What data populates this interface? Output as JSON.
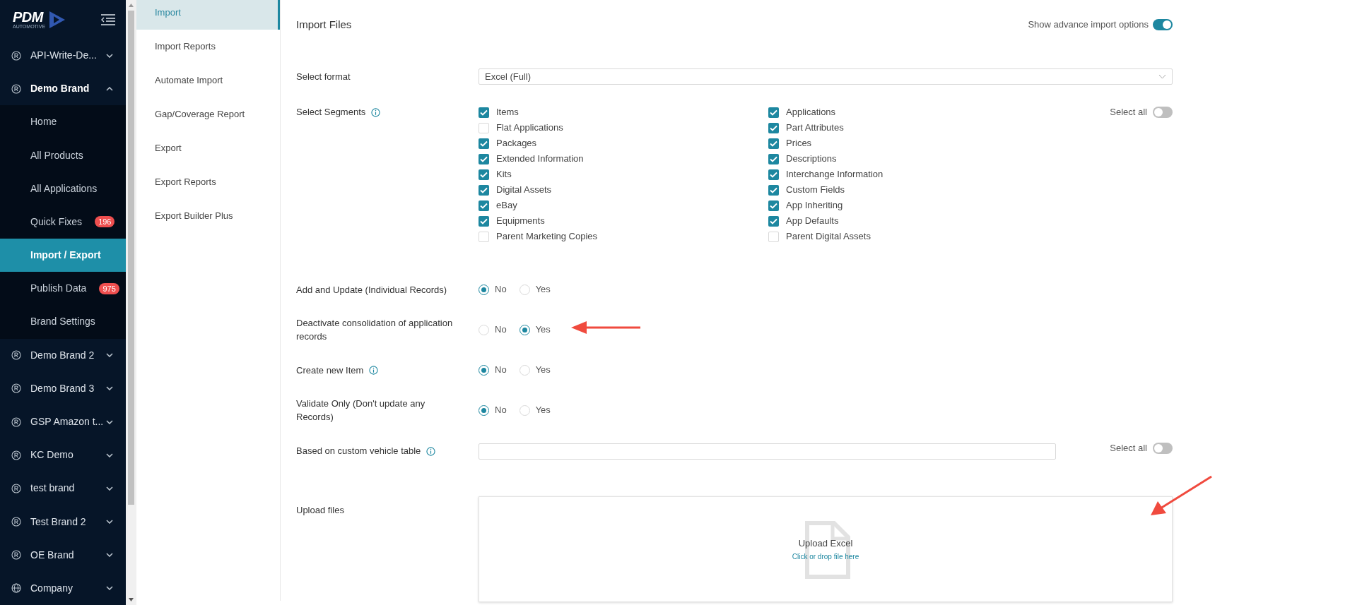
{
  "logo": {
    "wordmark": "PDM",
    "tagline": "AUTOMOTIVE"
  },
  "sidebar": {
    "items": [
      {
        "kind": "brand",
        "label": "API-Write-De...",
        "expanded": false,
        "selected": false
      },
      {
        "kind": "brand",
        "label": "Demo Brand",
        "expanded": true,
        "selected": false,
        "children": [
          {
            "label": "Home",
            "selected": false
          },
          {
            "label": "All Products",
            "selected": false
          },
          {
            "label": "All Applications",
            "selected": false
          },
          {
            "label": "Quick Fixes",
            "selected": false,
            "badge": "196"
          },
          {
            "label": "Import / Export",
            "selected": true
          },
          {
            "label": "Publish Data",
            "selected": false,
            "badge": "975"
          },
          {
            "label": "Brand Settings",
            "selected": false
          }
        ]
      },
      {
        "kind": "brand",
        "label": "Demo Brand 2",
        "expanded": false,
        "selected": false
      },
      {
        "kind": "brand",
        "label": "Demo Brand 3",
        "expanded": false,
        "selected": false
      },
      {
        "kind": "brand",
        "label": "GSP Amazon t...",
        "expanded": false,
        "selected": false
      },
      {
        "kind": "brand",
        "label": "KC Demo",
        "expanded": false,
        "selected": false
      },
      {
        "kind": "brand",
        "label": "test brand",
        "expanded": false,
        "selected": false
      },
      {
        "kind": "brand",
        "label": "Test Brand 2",
        "expanded": false,
        "selected": false
      },
      {
        "kind": "brand",
        "label": "OE Brand",
        "expanded": false,
        "selected": false
      },
      {
        "kind": "company",
        "label": "Company",
        "expanded": false,
        "selected": false
      }
    ]
  },
  "submenu": [
    {
      "label": "Import",
      "selected": true
    },
    {
      "label": "Import Reports",
      "selected": false
    },
    {
      "label": "Automate Import",
      "selected": false
    },
    {
      "label": "Gap/Coverage Report",
      "selected": false
    },
    {
      "label": "Export",
      "selected": false
    },
    {
      "label": "Export Reports",
      "selected": false
    },
    {
      "label": "Export Builder Plus",
      "selected": false
    }
  ],
  "main": {
    "title": "Import Files",
    "advanced_toggle": {
      "label": "Show advance import options",
      "on": true
    },
    "format": {
      "label": "Select format",
      "value": "Excel (Full)"
    },
    "segments": {
      "label": "Select Segments",
      "select_all": {
        "label": "Select all",
        "on": false
      },
      "columns": [
        [
          {
            "label": "Items",
            "checked": true
          },
          {
            "label": "Flat Applications",
            "checked": false
          },
          {
            "label": "Packages",
            "checked": true
          },
          {
            "label": "Extended Information",
            "checked": true
          },
          {
            "label": "Kits",
            "checked": true
          },
          {
            "label": "Digital Assets",
            "checked": true
          },
          {
            "label": "eBay",
            "checked": true
          },
          {
            "label": "Equipments",
            "checked": true
          },
          {
            "label": "Parent Marketing Copies",
            "checked": false
          }
        ],
        [
          {
            "label": "Applications",
            "checked": true
          },
          {
            "label": "Part Attributes",
            "checked": true
          },
          {
            "label": "Prices",
            "checked": true
          },
          {
            "label": "Descriptions",
            "checked": true
          },
          {
            "label": "Interchange Information",
            "checked": true
          },
          {
            "label": "Custom Fields",
            "checked": true
          },
          {
            "label": "App Inheriting",
            "checked": true
          },
          {
            "label": "App Defaults",
            "checked": true
          },
          {
            "label": "Parent Digital Assets",
            "checked": false
          }
        ]
      ]
    },
    "options": [
      {
        "label": "Add and Update (Individual Records)",
        "info": false,
        "choices": [
          {
            "label": "No",
            "selected": true
          },
          {
            "label": "Yes",
            "selected": false
          }
        ]
      },
      {
        "label": "Deactivate consolidation of application records",
        "info": false,
        "choices": [
          {
            "label": "No",
            "selected": false
          },
          {
            "label": "Yes",
            "selected": true
          }
        ]
      },
      {
        "label": "Create new Item",
        "info": true,
        "choices": [
          {
            "label": "No",
            "selected": true
          },
          {
            "label": "Yes",
            "selected": false
          }
        ]
      },
      {
        "label": "Validate Only (Don't update any Records)",
        "info": false,
        "choices": [
          {
            "label": "No",
            "selected": true
          },
          {
            "label": "Yes",
            "selected": false
          }
        ]
      }
    ],
    "vehicle_table": {
      "label": "Based on custom vehicle table",
      "select_all": {
        "label": "Select all",
        "on": false
      }
    },
    "upload": {
      "label": "Upload files",
      "title": "Upload Excel",
      "hint": "Click or drop file here"
    }
  }
}
